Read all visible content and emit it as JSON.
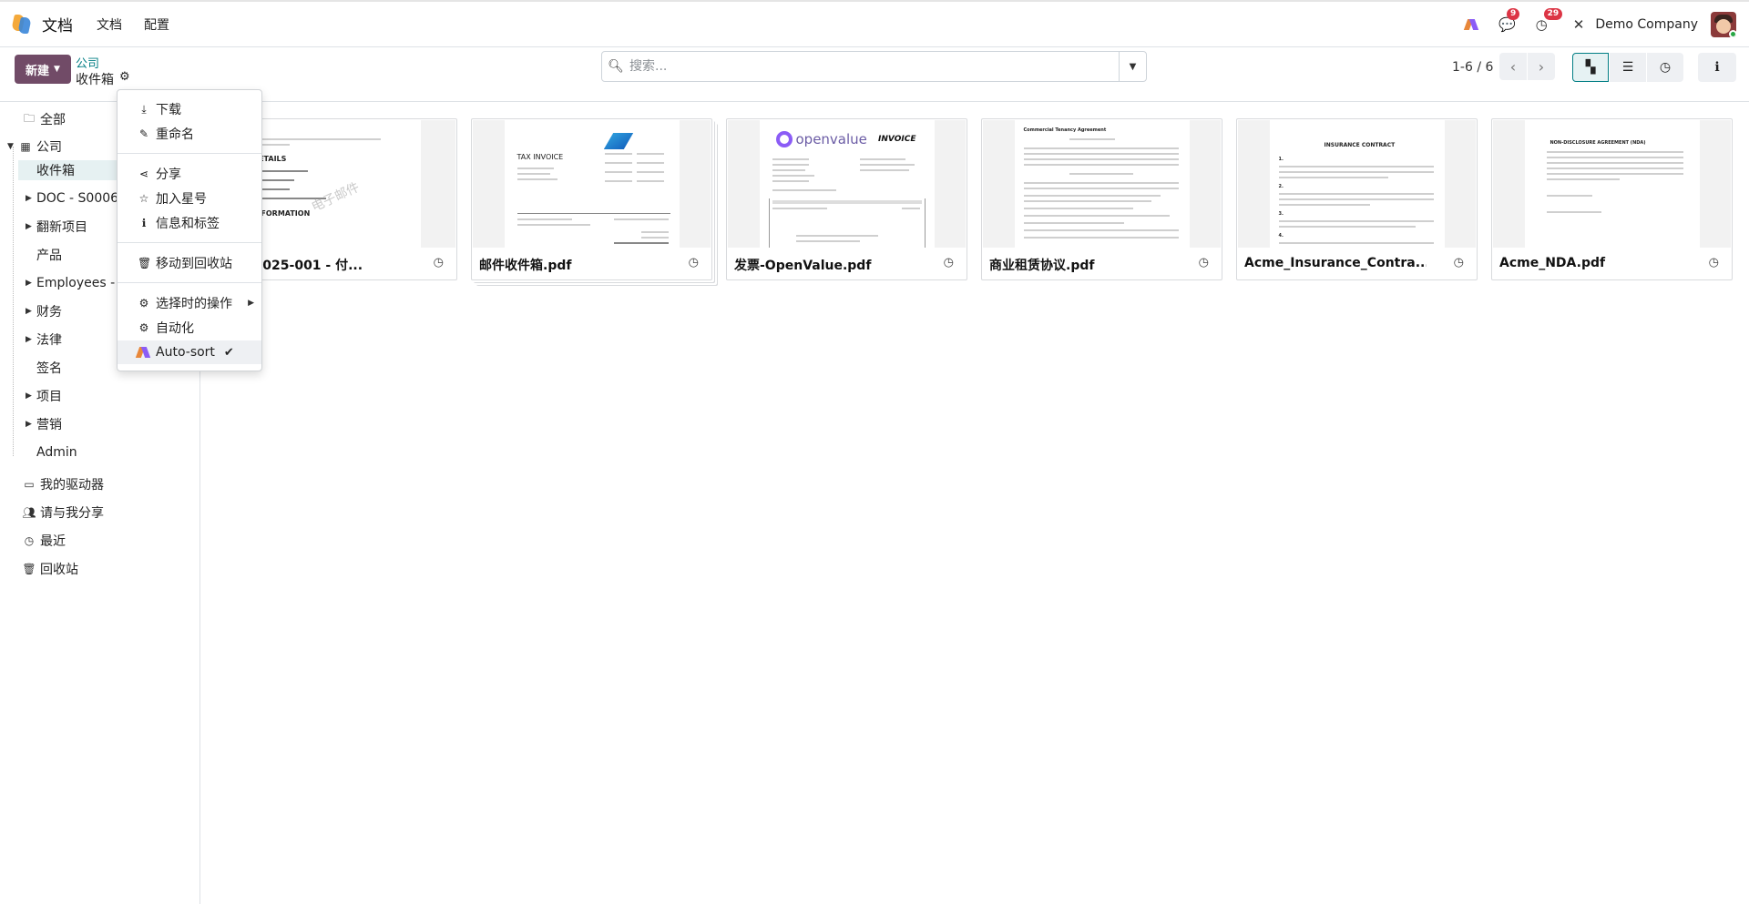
{
  "app": {
    "name": "文档"
  },
  "navbar": {
    "menus": [
      "文档",
      "配置"
    ],
    "messages_badge": "9",
    "activities_badge": "29",
    "company": "Demo Company"
  },
  "control": {
    "new_label": "新建",
    "breadcrumb_parent": "公司",
    "breadcrumb_current": "收件箱",
    "search_placeholder": "搜索...",
    "pager": "1-6 / 6"
  },
  "sidebar": {
    "all": "全部",
    "company": "公司",
    "children": [
      "收件箱",
      "DOC - S00060",
      "翻新项目",
      "产品",
      "Employees - Marc",
      "财务",
      "法律",
      "签名",
      "项目",
      "营销",
      "Admin"
    ],
    "my_drive": "我的驱动器",
    "shared": "请与我分享",
    "recent": "最近",
    "trash": "回收站"
  },
  "dropdown": {
    "download": "下载",
    "rename": "重命名",
    "share": "分享",
    "star": "加入星号",
    "info": "信息和标签",
    "move_trash": "移动到回收站",
    "actions": "选择时的操作",
    "automation": "自动化",
    "autosort": "Auto-sort"
  },
  "documents": [
    {
      "name": "INV-2025-001 - 付...",
      "thumb_title": "VOICE DETAILS",
      "thumb_sub": "LLING INFORMATION",
      "watermark": "电子邮件"
    },
    {
      "name": "邮件收件箱.pdf",
      "thumb_title": "TAX INVOICE"
    },
    {
      "name": "发票-OpenValue.pdf",
      "thumb_title": "INVOICE",
      "thumb_brand": "openvalue"
    },
    {
      "name": "商业租赁协议.pdf",
      "thumb_title": "Commercial Tenancy Agreement"
    },
    {
      "name": "Acme_Insurance_Contra...",
      "thumb_title": "INSURANCE CONTRACT"
    },
    {
      "name": "Acme_NDA.pdf",
      "thumb_title": "NON-DISCLOSURE AGREEMENT (NDA)"
    }
  ]
}
